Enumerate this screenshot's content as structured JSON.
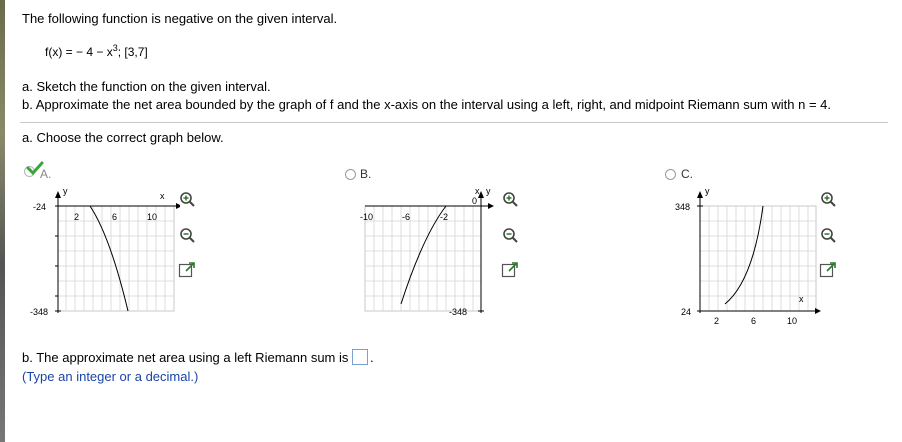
{
  "problem": {
    "intro": "The following function is negative on the given interval.",
    "function_text": "f(x) = − 4 − x",
    "exponent": "3",
    "interval_text": "; [3,7]",
    "part_a_instruction": "a. Sketch the function on the given interval.",
    "part_b_instruction": "b. Approximate the net area bounded by the graph of f and the x-axis on the interval using a left, right, and midpoint Riemann sum with n = 4."
  },
  "part_a": {
    "prompt": "a. Choose the correct graph below.",
    "selected": "A",
    "options": [
      {
        "label": "A.",
        "axis_x": "x",
        "axis_y": "y",
        "ticks_x": [
          "2",
          "6",
          "10"
        ],
        "ticks_y": [
          "-24",
          "-348"
        ]
      },
      {
        "label": "B.",
        "axis_x": "x",
        "axis_y": "y",
        "ticks_x": [
          "-10",
          "-6",
          "-2"
        ],
        "ticks_y": [
          "0",
          "-348"
        ]
      },
      {
        "label": "C.",
        "axis_x": "x",
        "axis_y": "y",
        "ticks_x": [
          "2",
          "6",
          "10"
        ],
        "ticks_y": [
          "348",
          "24"
        ]
      }
    ]
  },
  "part_b": {
    "prompt": "b. The approximate net area using a left Riemann sum is",
    "period": ".",
    "hint": "(Type an integer or a decimal.)",
    "answer_value": ""
  },
  "colors": {
    "check": "#3aa63a",
    "hint_text": "#1a44a8",
    "grid": "#c9c9c9",
    "divider": "#c8c8c8"
  },
  "icons": [
    "check-icon",
    "zoom-in-icon",
    "zoom-out-icon",
    "popout-icon"
  ]
}
